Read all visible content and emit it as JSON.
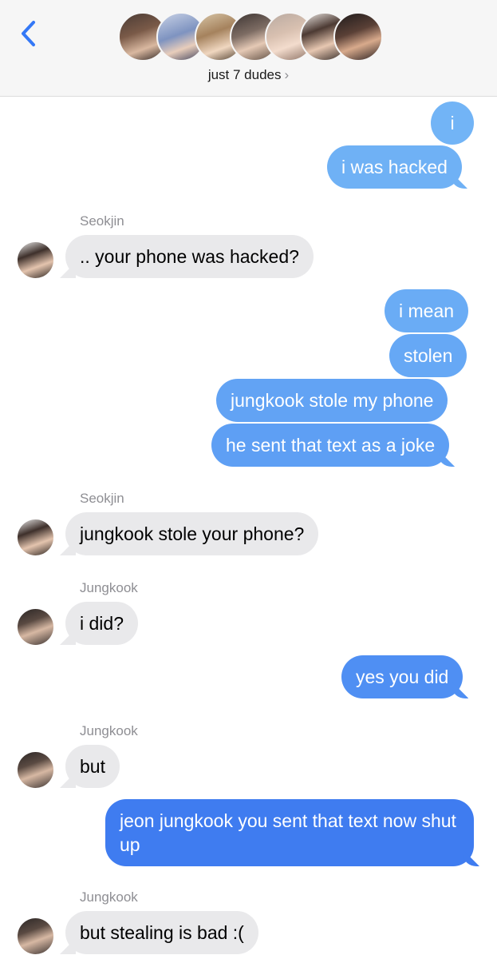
{
  "header": {
    "group_name": "just 7 dudes",
    "chevron": "›",
    "avatars": [
      "member-avatar-1",
      "member-avatar-2",
      "member-avatar-3",
      "member-avatar-4",
      "member-avatar-5",
      "member-avatar-6",
      "member-avatar-7"
    ]
  },
  "colors": {
    "sent_light": "#6fb1f5",
    "sent_mid": "#5fa0f4",
    "sent_dark": "#3e7bf0",
    "received": "#e9e9eb",
    "accent": "#3478f6"
  },
  "messages": [
    {
      "from": "me",
      "text": "i"
    },
    {
      "from": "me",
      "text": "i was hacked"
    },
    {
      "from": "Seokjin",
      "sender_label": "Seokjin",
      "text": ".. your phone was hacked?"
    },
    {
      "from": "me",
      "text": "i mean"
    },
    {
      "from": "me",
      "text": "stolen"
    },
    {
      "from": "me",
      "text": "jungkook stole my phone"
    },
    {
      "from": "me",
      "text": "he sent that text as a joke"
    },
    {
      "from": "Seokjin",
      "sender_label": "Seokjin",
      "text": "jungkook stole your phone?"
    },
    {
      "from": "Jungkook",
      "sender_label": "Jungkook",
      "text": "i did?"
    },
    {
      "from": "me",
      "text": "yes you did"
    },
    {
      "from": "Jungkook",
      "sender_label": "Jungkook",
      "text": "but"
    },
    {
      "from": "me",
      "text": "jeon jungkook you sent that text now shut up"
    },
    {
      "from": "Jungkook",
      "sender_label": "Jungkook",
      "text": "but stealing is bad :("
    }
  ]
}
